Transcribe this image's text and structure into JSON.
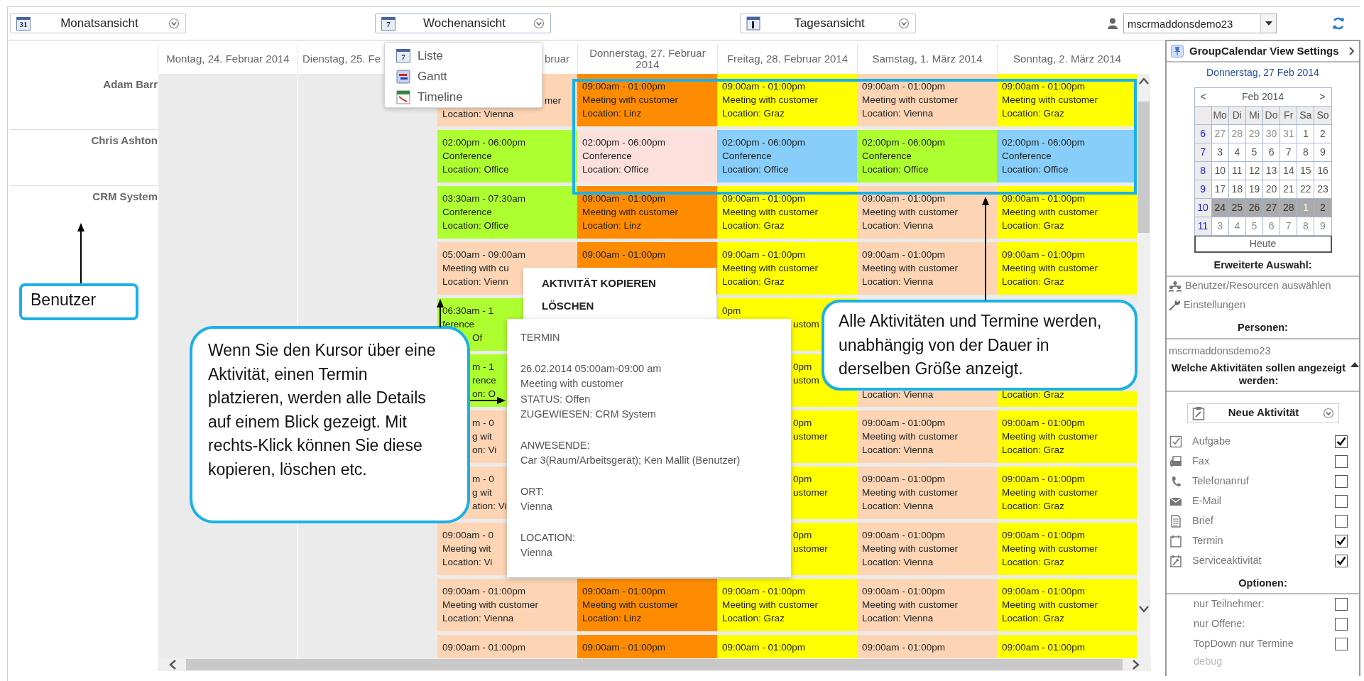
{
  "toolbar": {
    "views": [
      {
        "label": "Monatsansicht",
        "kind": "month",
        "icon_text": "31",
        "expanded": false
      },
      {
        "label": "Wochenansicht",
        "kind": "week",
        "icon_text": "7",
        "expanded": true,
        "menu": [
          {
            "label": "Liste",
            "kind": "list",
            "icon_text": "7"
          },
          {
            "label": "Gantt",
            "kind": "gantt"
          },
          {
            "label": "Timeline",
            "kind": "timeline"
          }
        ]
      },
      {
        "label": "Tagesansicht",
        "kind": "day",
        "expanded": false
      }
    ],
    "user_select": {
      "value": "mscrmaddonsdemo23"
    }
  },
  "calendar": {
    "days": [
      {
        "label": "Montag, 24. Februar 2014"
      },
      {
        "label": "Dienstag, 25. Fe"
      },
      {
        "label": "bruar"
      },
      {
        "label": "Donnerstag, 27. Februar 2014"
      },
      {
        "label": "Freitag, 28. Februar 2014"
      },
      {
        "label": "Samstag, 1. März 2014"
      },
      {
        "label": "Sonntag, 2. März 2014"
      }
    ],
    "resources": [
      {
        "name": "Adam Barr",
        "slots": [
          [
            {
              "color": "#fdd5b4",
              "anchored_bottom": true,
              "lines": [
                "mer",
                "Location: Vienna"
              ]
            },
            {
              "color": "#ff8c00",
              "lines": [
                "09:00am - 01:00pm",
                "Meeting with customer",
                "Location: Linz"
              ]
            },
            {
              "color": "#ffff00",
              "lines": [
                "09:00am - 01:00pm",
                "Meeting with customer",
                "Location: Graz"
              ]
            },
            {
              "color": "#fdd5b4",
              "lines": [
                "09:00am - 01:00pm",
                "Meeting with customer",
                "Location: Vienna"
              ]
            },
            {
              "color": "#ffff00",
              "lines": [
                "09:00am - 01:00pm",
                "Meeting with customer",
                "Location: Graz"
              ]
            }
          ]
        ]
      },
      {
        "name": "Chris Ashton",
        "slots": [
          [
            {
              "color": "#adff2f",
              "lines": [
                "02:00pm - 06:00pm",
                "Conference",
                "Location: Office"
              ]
            },
            {
              "color": "#fde0dc",
              "lines": [
                "02:00pm - 06:00pm",
                "Conference",
                "Location: Office"
              ]
            },
            {
              "color": "#87cefa",
              "lines": [
                "02:00pm - 06:00pm",
                "Conference",
                "Location: Office"
              ]
            },
            {
              "color": "#adff2f",
              "lines": [
                "02:00pm - 06:00pm",
                "Conference",
                "Location: Office"
              ]
            },
            {
              "color": "#87cefa",
              "lines": [
                "02:00pm - 06:00pm",
                "Conference",
                "Location: Office"
              ]
            }
          ]
        ]
      },
      {
        "name": "CRM System",
        "slots": [
          [
            {
              "color": "#adff2f",
              "lines": [
                "03:30am - 07:30am",
                "Conference",
                "Location: Office"
              ]
            },
            {
              "color": "#ff8c00",
              "lines": [
                "09:00am - 01:00pm",
                "Meeting with customer",
                "Location: Linz"
              ]
            },
            {
              "color": "#ffff00",
              "lines": [
                "09:00am - 01:00pm",
                "Meeting with customer",
                "Location: Graz"
              ]
            },
            {
              "color": "#fdd5b4",
              "lines": [
                "09:00am - 01:00pm",
                "Meeting with customer",
                "Location: Vienna"
              ]
            },
            {
              "color": "#ffff00",
              "lines": [
                "09:00am - 01:00pm",
                "Meeting with customer",
                "Location: Graz"
              ]
            }
          ],
          [
            {
              "color": "#fdd5b4",
              "lines": [
                "05:00am - 09:00am",
                "Meeting with cu",
                "Location: Vienn"
              ]
            },
            {
              "color": "#ff8c00",
              "lines": [
                "09:00am - 01:00pm"
              ]
            },
            {
              "color": "#ffff00",
              "lines": [
                "09:00am - 01:00pm",
                "Meeting with customer",
                "Location: Graz"
              ]
            },
            {
              "color": "#fdd5b4",
              "lines": [
                "09:00am - 01:00pm",
                "Meeting with customer",
                "Location: Vienna"
              ]
            },
            {
              "color": "#ffff00",
              "lines": [
                "09:00am - 01:00pm",
                "Meeting with customer",
                "Location: Graz"
              ]
            }
          ],
          [
            {
              "color": "#adff2f",
              "lines": [
                "06:30am - 1",
                "ference",
                "Of"
              ]
            },
            {
              "covered": true
            },
            {
              "color": "#ffff00",
              "lines": [
                "0pm",
                "ustom"
              ]
            },
            {
              "covered": true
            },
            {
              "covered": true
            }
          ],
          [
            {
              "color": "#adff2f",
              "lines": [
                "m - 1",
                "rence",
                "on: O"
              ]
            },
            {
              "covered": true
            },
            {
              "color": "#ffff00",
              "lines": [
                "0pm",
                "ustom"
              ]
            },
            {
              "color": "#fdd5b4",
              "anchored_bottom": true,
              "lines": [
                "Location: Vienna"
              ]
            },
            {
              "color": "#ffff00",
              "anchored_bottom": true,
              "lines": [
                "Location: Graz"
              ]
            }
          ],
          [
            {
              "color": "#fdd5b4",
              "lines": [
                "m - 0",
                "g wit",
                "on: Vi"
              ]
            },
            {
              "covered": true
            },
            {
              "color": "#ffff00",
              "lines": [
                "0pm",
                "ustomer"
              ]
            },
            {
              "color": "#fdd5b4",
              "lines": [
                "09:00am - 01:00pm",
                "Meeting with customer",
                "Location: Vienna"
              ]
            },
            {
              "color": "#ffff00",
              "lines": [
                "09:00am - 01:00pm",
                "Meeting with customer",
                "Location: Graz"
              ]
            }
          ],
          [
            {
              "color": "#fdd5b4",
              "lines": [
                "m - 0",
                "g wit",
                "ation: Vi"
              ]
            },
            {
              "covered": true
            },
            {
              "color": "#ffff00",
              "lines": [
                "0pm",
                "ustomer"
              ]
            },
            {
              "color": "#fdd5b4",
              "lines": [
                "09:00am - 01:00pm",
                "Meeting with customer",
                "Location: Vienna"
              ]
            },
            {
              "color": "#ffff00",
              "lines": [
                "09:00am - 01:00pm",
                "Meeting with customer",
                "Location: Graz"
              ]
            }
          ],
          [
            {
              "color": "#fdd5b4",
              "lines": [
                "09:00am - 0",
                "Meeting wit",
                "Location: Vi"
              ]
            },
            {
              "covered": true
            },
            {
              "color": "#ffff00",
              "lines": [
                "0pm",
                "ustomer"
              ]
            },
            {
              "color": "#fdd5b4",
              "lines": [
                "09:00am - 01:00pm",
                "Meeting with customer",
                "Location: Vienna"
              ]
            },
            {
              "color": "#ffff00",
              "lines": [
                "09:00am - 01:00pm",
                "Meeting with customer",
                "Location: Graz"
              ]
            }
          ],
          [
            {
              "color": "#fdd5b4",
              "lines": [
                "09:00am - 01:00pm",
                "Meeting with customer",
                "Location: Vienna"
              ]
            },
            {
              "color": "#ff8c00",
              "lines": [
                "09:00am - 01:00pm",
                "Meeting with customer",
                "Location: Linz"
              ]
            },
            {
              "color": "#ffff00",
              "lines": [
                "09:00am - 01:00pm",
                "Meeting with customer",
                "Location: Graz"
              ]
            },
            {
              "color": "#fdd5b4",
              "lines": [
                "09:00am - 01:00pm",
                "Meeting with customer",
                "Location: Vienna"
              ]
            },
            {
              "color": "#ffff00",
              "lines": [
                "09:00am - 01:00pm",
                "Meeting with customer",
                "Location: Graz"
              ]
            }
          ],
          [
            {
              "color": "#fdd5b4",
              "lines": [
                "09:00am - 01:00pm"
              ]
            },
            {
              "color": "#ff8c00",
              "lines": [
                "09:00am - 01:00pm"
              ]
            },
            {
              "color": "#ffff00",
              "lines": [
                "09:00am - 01:00pm"
              ]
            },
            {
              "color": "#fdd5b4",
              "lines": [
                "09:00am - 01:00pm"
              ]
            },
            {
              "color": "#ffff00",
              "lines": [
                "09:00am - 01:00pm"
              ]
            }
          ]
        ]
      }
    ]
  },
  "context_menu": {
    "items": [
      "AKTIVITÄT KOPIEREN",
      "LÖSCHEN"
    ]
  },
  "tooltip": {
    "sections": [
      [
        "TERMIN"
      ],
      [
        "26.02.2014 05:00am-09:00 am",
        "Meeting with customer",
        "STATUS: Offen",
        "ZUGEWIESEN: CRM System"
      ],
      [
        "ANWESENDE:",
        "Car 3(Raum/Arbeitsgerät); Ken Mallit (Benutzer)"
      ],
      [
        "ORT:",
        "Vienna"
      ],
      [
        "LOCATION:",
        "Vienna"
      ]
    ]
  },
  "callouts": [
    {
      "text": "Benutzer"
    },
    {
      "text": "Wenn Sie den Kursor über eine Aktivität, einen Termin platzieren, werden alle Details auf einem Blick gezeigt. Mit rechts-Klick können Sie diese kopieren, löschen etc."
    },
    {
      "text": "Alle Aktivitäten und Termine werden, unabhängig von der Dauer in derselben Größe anzeigt."
    }
  ],
  "sidebar": {
    "title": "GroupCalendar View Settings",
    "selected_date": "Donnerstag, 27 Feb 2014",
    "mini_calendar": {
      "prev": "<",
      "month": "Feb 2014",
      "next": ">",
      "weekdays": [
        "Mo",
        "Di",
        "Mi",
        "Do",
        "Fr",
        "Sa",
        "So"
      ],
      "weeks": [
        {
          "number": "6",
          "selected": false,
          "days": [
            {
              "day": "27",
              "other_month": true
            },
            {
              "day": "28",
              "other_month": true
            },
            {
              "day": "29",
              "other_month": true
            },
            {
              "day": "30",
              "other_month": true
            },
            {
              "day": "31",
              "other_month": true
            },
            {
              "day": "1",
              "other_month": false
            },
            {
              "day": "2",
              "other_month": false
            }
          ]
        },
        {
          "number": "7",
          "selected": false,
          "days": [
            {
              "day": "3",
              "other_month": false
            },
            {
              "day": "4",
              "other_month": false
            },
            {
              "day": "5",
              "other_month": false
            },
            {
              "day": "6",
              "other_month": false
            },
            {
              "day": "7",
              "other_month": false
            },
            {
              "day": "8",
              "other_month": false
            },
            {
              "day": "9",
              "other_month": false
            }
          ]
        },
        {
          "number": "8",
          "selected": false,
          "days": [
            {
              "day": "10",
              "other_month": false
            },
            {
              "day": "11",
              "other_month": false
            },
            {
              "day": "12",
              "other_month": false
            },
            {
              "day": "13",
              "other_month": false
            },
            {
              "day": "14",
              "other_month": false
            },
            {
              "day": "15",
              "other_month": false
            },
            {
              "day": "16",
              "other_month": false
            }
          ]
        },
        {
          "number": "9",
          "selected": false,
          "days": [
            {
              "day": "17",
              "other_month": false
            },
            {
              "day": "18",
              "other_month": false
            },
            {
              "day": "19",
              "other_month": false
            },
            {
              "day": "20",
              "other_month": false
            },
            {
              "day": "21",
              "other_month": false
            },
            {
              "day": "22",
              "other_month": false
            },
            {
              "day": "23",
              "other_month": false
            }
          ]
        },
        {
          "number": "10",
          "selected": true,
          "days": [
            {
              "day": "24",
              "other_month": false
            },
            {
              "day": "25",
              "other_month": false
            },
            {
              "day": "26",
              "other_month": false
            },
            {
              "day": "27",
              "other_month": false
            },
            {
              "day": "28",
              "other_month": false
            },
            {
              "day": "1",
              "other_month": true
            },
            {
              "day": "2",
              "other_month": false
            }
          ]
        },
        {
          "number": "11",
          "selected": false,
          "days": [
            {
              "day": "3",
              "other_month": true
            },
            {
              "day": "4",
              "other_month": true
            },
            {
              "day": "5",
              "other_month": true
            },
            {
              "day": "6",
              "other_month": true
            },
            {
              "day": "7",
              "other_month": true
            },
            {
              "day": "8",
              "other_month": true
            },
            {
              "day": "9",
              "other_month": true
            }
          ]
        }
      ],
      "today_button": "Heute"
    },
    "advanced_heading": "Erweiterte Auswahl:",
    "links": [
      {
        "label": "Benutzer/Resourcen auswählen",
        "kind": "people"
      },
      {
        "label": "Einstellungen",
        "kind": "wrench"
      }
    ],
    "persons_heading": "Personen:",
    "persons": [
      "mscrmaddonsdemo23"
    ],
    "activities_heading": "Welche Aktivitäten sollen angezeigt werden:",
    "new_activity_button": "Neue Aktivität",
    "activity_types": [
      {
        "label": "Aufgabe",
        "kind": "task",
        "checked": true
      },
      {
        "label": "Fax",
        "kind": "fax",
        "checked": false
      },
      {
        "label": "Telefonanruf",
        "kind": "phone",
        "checked": false
      },
      {
        "label": "E-Mail",
        "kind": "mail",
        "checked": false
      },
      {
        "label": "Brief",
        "kind": "letter",
        "checked": false
      },
      {
        "label": "Termin",
        "kind": "appointment",
        "checked": true
      },
      {
        "label": "Serviceaktivität",
        "kind": "service",
        "checked": true
      }
    ],
    "options_heading": "Optionen:",
    "options": [
      {
        "label": "nur Teilnehmer:",
        "checked": false
      },
      {
        "label": "nur Offene:",
        "checked": false
      },
      {
        "label": "TopDown nur Termine",
        "checked": false
      }
    ],
    "debug_label": "debug"
  }
}
